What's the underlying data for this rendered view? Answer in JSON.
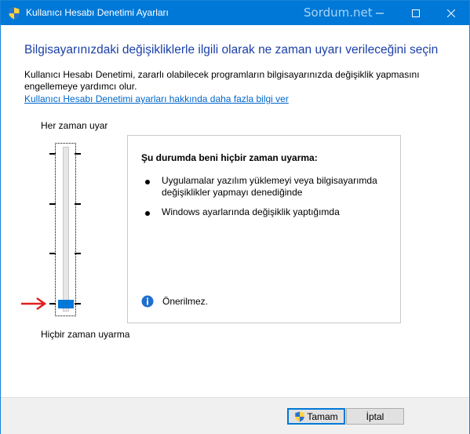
{
  "window": {
    "title": "Kullanıcı Hesabı Denetimi Ayarları",
    "watermark": "Sordum.net",
    "accent_color": "#0078d7",
    "title_icon": "uac-shield-icon"
  },
  "main": {
    "heading": "Bilgisayarınızdaki değişikliklerle ilgili olarak ne zaman uyarı verileceğini seçin",
    "description": "Kullanıcı Hesabı Denetimi, zararlı olabilecek programların bilgisayarınızda değişiklik yapmasını engellemeye yardımcı olur.",
    "link": "Kullanıcı Hesabı Denetimi ayarları hakkında daha fazla bilgi ver"
  },
  "slider": {
    "top_label": "Her zaman uyar",
    "bottom_label": "Hiçbir zaman uyarma",
    "levels": 4,
    "selected_level": 1
  },
  "info": {
    "title": "Şu durumda beni hiçbir zaman uyarma:",
    "bullets": [
      "Uygulamalar yazılım yüklemeyi veya bilgisayarımda değişiklikler yapmayı denediğinde",
      "Windows ayarlarında değişiklik yaptığımda"
    ],
    "note": "Önerilmez.",
    "note_icon": "info-icon"
  },
  "buttons": {
    "ok": "Tamam",
    "cancel": "İptal"
  }
}
